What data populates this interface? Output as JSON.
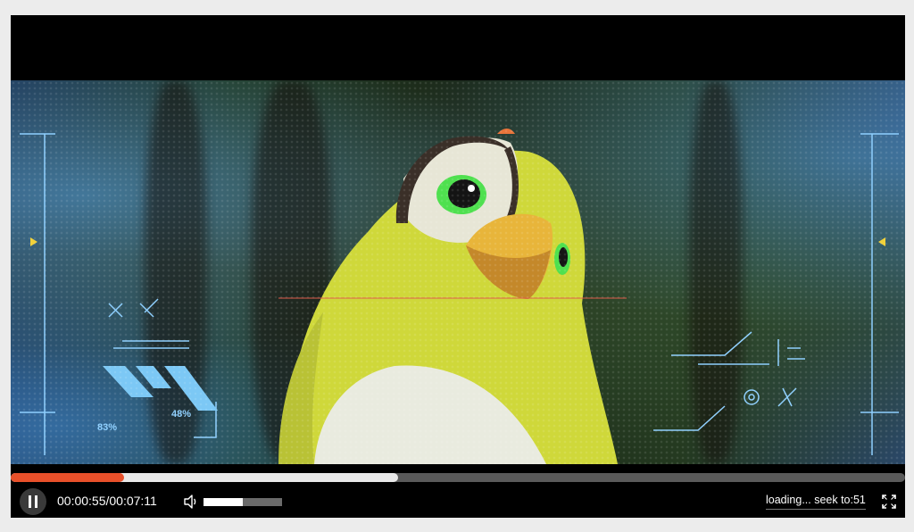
{
  "player": {
    "time_display": "00:00:55/00:07:11",
    "status_text": "loading... seek to:51",
    "progress_played_fraction": 0.127,
    "progress_buffered_fraction": 0.433,
    "volume_fraction": 0.5,
    "state": "playing",
    "accent_color": "#e8502a"
  },
  "icons": {
    "play_pause": "pause-icon",
    "volume": "speaker-icon",
    "fullscreen": "fullscreen-icon"
  },
  "hud": {
    "left_percent": "83%",
    "left_percent_2": "48%"
  }
}
